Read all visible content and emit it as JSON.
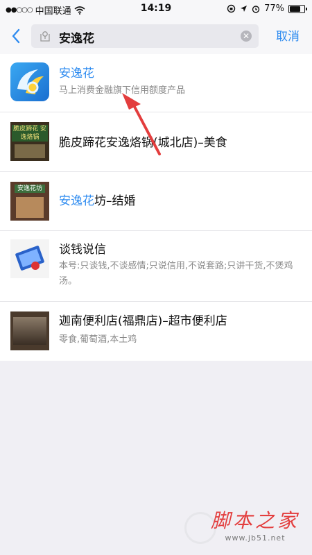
{
  "status_bar": {
    "carrier": "中国联通",
    "time": "14:19",
    "battery": "77%",
    "battery_level": 0.77
  },
  "search": {
    "query": "安逸花",
    "cancel_label": "取消"
  },
  "results": [
    {
      "title_highlight": "安逸花",
      "title_rest": "",
      "description": "马上消费金融旗下信用额度产品"
    },
    {
      "title_highlight": "",
      "title_rest": "脆皮蹄花安逸烙锅(城北店)–美食",
      "description": "",
      "thumb_text": "脆皮蹄花 安逸烙锅"
    },
    {
      "title_highlight": "安逸花",
      "title_rest": "坊–结婚",
      "description": "",
      "thumb_text": "安逸花坊"
    },
    {
      "title_highlight": "",
      "title_rest": "谈钱说信",
      "description": "本号:只谈钱,不谈感情;只说信用,不说套路;只讲干货,不煲鸡汤。"
    },
    {
      "title_highlight": "",
      "title_rest": "迦南便利店(福鼎店)–超市便利店",
      "description": "零食,葡萄酒,本土鸡"
    }
  ],
  "watermark": {
    "main": "脚本之家",
    "sub": "www.jb51.net"
  },
  "colors": {
    "accent": "#2f8cf0",
    "annotation_arrow": "#e33d3d"
  }
}
